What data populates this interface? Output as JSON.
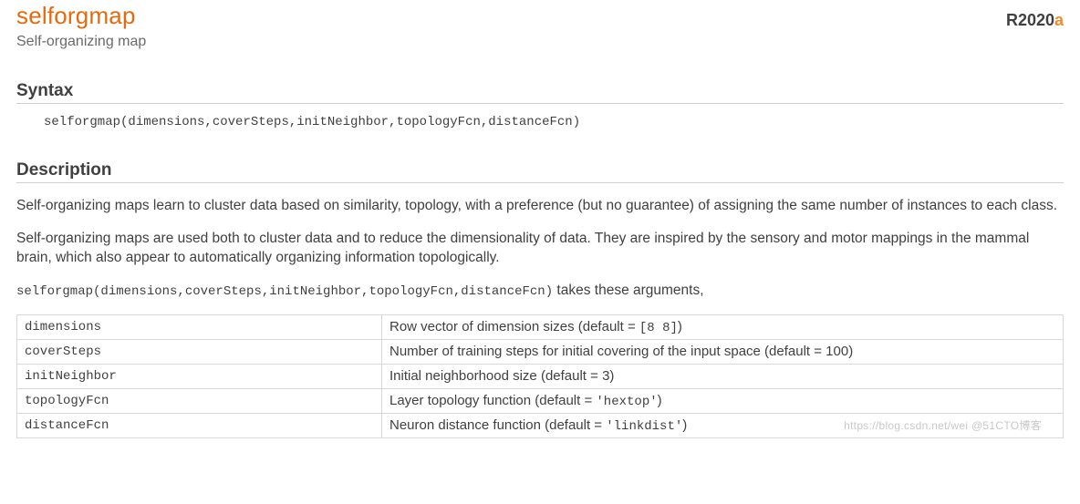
{
  "header": {
    "title": "selforgmap",
    "subtitle": "Self-organizing map",
    "release_prefix": "R",
    "release_year": "2020",
    "release_suffix": "a"
  },
  "syntax": {
    "heading": "Syntax",
    "line": "selforgmap(dimensions,coverSteps,initNeighbor,topologyFcn,distanceFcn)"
  },
  "description": {
    "heading": "Description",
    "para1": "Self-organizing maps learn to cluster data based on similarity, topology, with a preference (but no guarantee) of assigning the same number of instances to each class.",
    "para2": "Self-organizing maps are used both to cluster data and to reduce the dimensionality of data. They are inspired by the sensory and motor mappings in the mammal brain, which also appear to automatically organizing information topologically.",
    "call_code": "selforgmap(dimensions,coverSteps,initNeighbor,topologyFcn,distanceFcn)",
    "call_tail": " takes these arguments,"
  },
  "args": [
    {
      "name": "dimensions",
      "desc_pre": "Row vector of dimension sizes (default = ",
      "code": "[8 8]",
      "desc_post": ")"
    },
    {
      "name": "coverSteps",
      "desc_pre": "Number of training steps for initial covering of the input space (default = 100)",
      "code": "",
      "desc_post": ""
    },
    {
      "name": "initNeighbor",
      "desc_pre": "Initial neighborhood size (default = 3)",
      "code": "",
      "desc_post": ""
    },
    {
      "name": "topologyFcn",
      "desc_pre": "Layer topology function (default = ",
      "code": "'hextop'",
      "desc_post": ")"
    },
    {
      "name": "distanceFcn",
      "desc_pre": "Neuron distance function (default = ",
      "code": "'linkdist'",
      "desc_post": ")"
    }
  ],
  "watermark": "https://blog.csdn.net/wei @51CTO博客"
}
